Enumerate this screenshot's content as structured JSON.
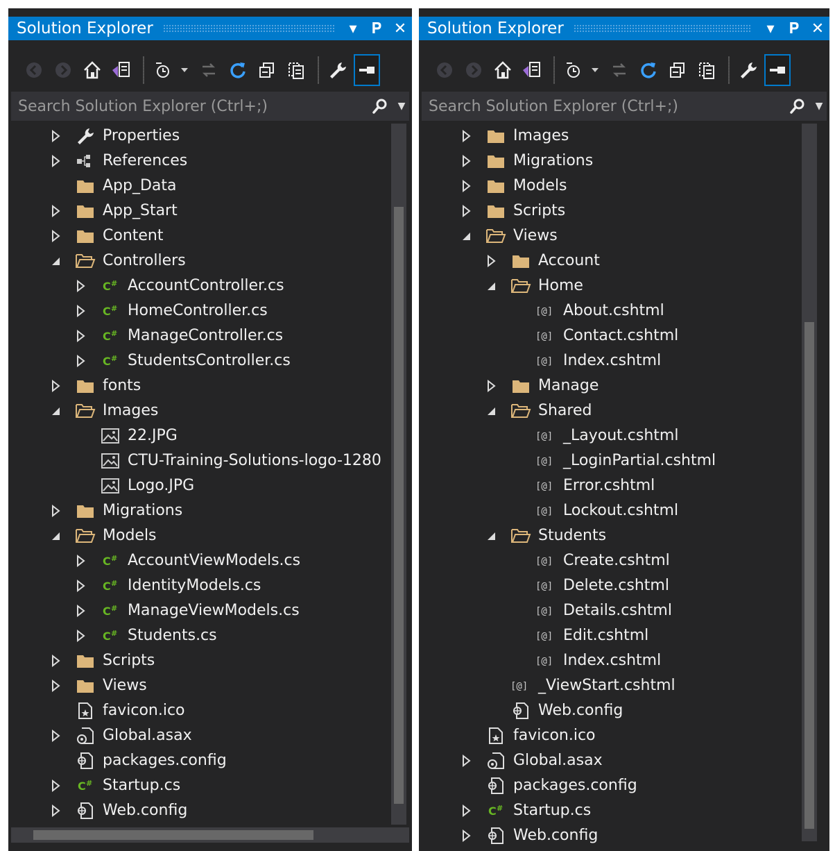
{
  "left": {
    "title": "Solution Explorer",
    "search_placeholder": "Search Solution Explorer (Ctrl+;)",
    "tree": [
      {
        "label": "Properties",
        "icon": "wrench-icon",
        "arrow": "right",
        "level": 1
      },
      {
        "label": "References",
        "icon": "references-icon",
        "arrow": "right",
        "level": 1
      },
      {
        "label": "App_Data",
        "icon": "folder-icon",
        "arrow": "none",
        "level": 1
      },
      {
        "label": "App_Start",
        "icon": "folder-icon",
        "arrow": "right",
        "level": 1
      },
      {
        "label": "Content",
        "icon": "folder-icon",
        "arrow": "right",
        "level": 1
      },
      {
        "label": "Controllers",
        "icon": "folder-open-icon",
        "arrow": "down",
        "level": 1
      },
      {
        "label": "AccountController.cs",
        "icon": "csharp-icon",
        "arrow": "right",
        "level": 2
      },
      {
        "label": "HomeController.cs",
        "icon": "csharp-icon",
        "arrow": "right",
        "level": 2
      },
      {
        "label": "ManageController.cs",
        "icon": "csharp-icon",
        "arrow": "right",
        "level": 2
      },
      {
        "label": "StudentsController.cs",
        "icon": "csharp-icon",
        "arrow": "right",
        "level": 2
      },
      {
        "label": "fonts",
        "icon": "folder-icon",
        "arrow": "right",
        "level": 1
      },
      {
        "label": "Images",
        "icon": "folder-open-icon",
        "arrow": "down",
        "level": 1
      },
      {
        "label": "22.JPG",
        "icon": "image-icon",
        "arrow": "none",
        "level": 2
      },
      {
        "label": "CTU-Training-Solutions-logo-1280",
        "icon": "image-icon",
        "arrow": "none",
        "level": 2
      },
      {
        "label": "Logo.JPG",
        "icon": "image-icon",
        "arrow": "none",
        "level": 2
      },
      {
        "label": "Migrations",
        "icon": "folder-icon",
        "arrow": "right",
        "level": 1
      },
      {
        "label": "Models",
        "icon": "folder-open-icon",
        "arrow": "down",
        "level": 1
      },
      {
        "label": "AccountViewModels.cs",
        "icon": "csharp-icon",
        "arrow": "right",
        "level": 2
      },
      {
        "label": "IdentityModels.cs",
        "icon": "csharp-icon",
        "arrow": "right",
        "level": 2
      },
      {
        "label": "ManageViewModels.cs",
        "icon": "csharp-icon",
        "arrow": "right",
        "level": 2
      },
      {
        "label": "Students.cs",
        "icon": "csharp-icon",
        "arrow": "right",
        "level": 2
      },
      {
        "label": "Scripts",
        "icon": "folder-icon",
        "arrow": "right",
        "level": 1
      },
      {
        "label": "Views",
        "icon": "folder-icon",
        "arrow": "right",
        "level": 1
      },
      {
        "label": "favicon.ico",
        "icon": "favicon-file-icon",
        "arrow": "none",
        "level": 1
      },
      {
        "label": "Global.asax",
        "icon": "global-asax-icon",
        "arrow": "right",
        "level": 1
      },
      {
        "label": "packages.config",
        "icon": "config-file-icon",
        "arrow": "none",
        "level": 1
      },
      {
        "label": "Startup.cs",
        "icon": "csharp-icon",
        "arrow": "right",
        "level": 1
      },
      {
        "label": "Web.config",
        "icon": "config-file-icon",
        "arrow": "right",
        "level": 1
      }
    ]
  },
  "right": {
    "title": "Solution Explorer",
    "search_placeholder": "Search Solution Explorer (Ctrl+;)",
    "tree": [
      {
        "label": "Images",
        "icon": "folder-icon",
        "arrow": "right",
        "level": 1
      },
      {
        "label": "Migrations",
        "icon": "folder-icon",
        "arrow": "right",
        "level": 1
      },
      {
        "label": "Models",
        "icon": "folder-icon",
        "arrow": "right",
        "level": 1
      },
      {
        "label": "Scripts",
        "icon": "folder-icon",
        "arrow": "right",
        "level": 1
      },
      {
        "label": "Views",
        "icon": "folder-open-icon",
        "arrow": "down",
        "level": 1
      },
      {
        "label": "Account",
        "icon": "folder-icon",
        "arrow": "right",
        "level": 2
      },
      {
        "label": "Home",
        "icon": "folder-open-icon",
        "arrow": "down",
        "level": 2
      },
      {
        "label": "About.cshtml",
        "icon": "razor-icon",
        "arrow": "none",
        "level": 3
      },
      {
        "label": "Contact.cshtml",
        "icon": "razor-icon",
        "arrow": "none",
        "level": 3
      },
      {
        "label": "Index.cshtml",
        "icon": "razor-icon",
        "arrow": "none",
        "level": 3
      },
      {
        "label": "Manage",
        "icon": "folder-icon",
        "arrow": "right",
        "level": 2
      },
      {
        "label": "Shared",
        "icon": "folder-open-icon",
        "arrow": "down",
        "level": 2
      },
      {
        "label": "_Layout.cshtml",
        "icon": "razor-icon",
        "arrow": "none",
        "level": 3
      },
      {
        "label": "_LoginPartial.cshtml",
        "icon": "razor-icon",
        "arrow": "none",
        "level": 3
      },
      {
        "label": "Error.cshtml",
        "icon": "razor-icon",
        "arrow": "none",
        "level": 3
      },
      {
        "label": "Lockout.cshtml",
        "icon": "razor-icon",
        "arrow": "none",
        "level": 3
      },
      {
        "label": "Students",
        "icon": "folder-open-icon",
        "arrow": "down",
        "level": 2
      },
      {
        "label": "Create.cshtml",
        "icon": "razor-icon",
        "arrow": "none",
        "level": 3
      },
      {
        "label": "Delete.cshtml",
        "icon": "razor-icon",
        "arrow": "none",
        "level": 3
      },
      {
        "label": "Details.cshtml",
        "icon": "razor-icon",
        "arrow": "none",
        "level": 3
      },
      {
        "label": "Edit.cshtml",
        "icon": "razor-icon",
        "arrow": "none",
        "level": 3
      },
      {
        "label": "Index.cshtml",
        "icon": "razor-icon",
        "arrow": "none",
        "level": 3
      },
      {
        "label": "_ViewStart.cshtml",
        "icon": "razor-icon",
        "arrow": "none",
        "level": 2
      },
      {
        "label": "Web.config",
        "icon": "config-file-icon",
        "arrow": "none",
        "level": 2
      },
      {
        "label": "favicon.ico",
        "icon": "favicon-file-icon",
        "arrow": "none",
        "level": 1
      },
      {
        "label": "Global.asax",
        "icon": "global-asax-icon",
        "arrow": "right",
        "level": 1
      },
      {
        "label": "packages.config",
        "icon": "config-file-icon",
        "arrow": "none",
        "level": 1
      },
      {
        "label": "Startup.cs",
        "icon": "csharp-icon",
        "arrow": "right",
        "level": 1
      },
      {
        "label": "Web.config",
        "icon": "config-file-icon",
        "arrow": "right",
        "level": 1
      }
    ]
  },
  "colors": {
    "accent": "#007acc",
    "panel_bg": "#252526",
    "text": "#f1f1f1",
    "folder": "#dcb67a",
    "csharp": "#68b723"
  }
}
